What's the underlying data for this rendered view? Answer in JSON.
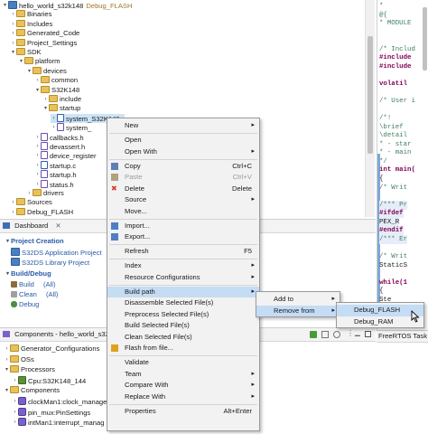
{
  "explorer": {
    "rows": [
      {
        "label": "hello_world_s32k148",
        "suffix": "Debug_FLASH",
        "indent": 0,
        "tw": "▾",
        "icon": "proj"
      },
      {
        "label": "Binaries",
        "indent": 1,
        "tw": "›",
        "icon": "folder"
      },
      {
        "label": "Includes",
        "indent": 1,
        "tw": "›",
        "icon": "folder"
      },
      {
        "label": "Generated_Code",
        "indent": 1,
        "tw": "›",
        "icon": "folder"
      },
      {
        "label": "Project_Settings",
        "indent": 1,
        "tw": "›",
        "icon": "folder"
      },
      {
        "label": "SDK",
        "indent": 1,
        "tw": "▾",
        "icon": "folder"
      },
      {
        "label": "platform",
        "indent": 2,
        "tw": "▾",
        "icon": "folder"
      },
      {
        "label": "devices",
        "indent": 3,
        "tw": "▾",
        "icon": "folder"
      },
      {
        "label": "common",
        "indent": 4,
        "tw": "›",
        "icon": "folder"
      },
      {
        "label": "S32K148",
        "indent": 4,
        "tw": "▾",
        "icon": "folder"
      },
      {
        "label": "include",
        "indent": 5,
        "tw": "›",
        "icon": "folder"
      },
      {
        "label": "startup",
        "indent": 5,
        "tw": "▾",
        "icon": "folder"
      },
      {
        "label": "system_S32K148.c",
        "indent": 6,
        "tw": "›",
        "icon": "c",
        "selected": true
      },
      {
        "label": "system_",
        "indent": 6,
        "tw": "›",
        "icon": "h"
      },
      {
        "label": "callbacks.h",
        "indent": 4,
        "tw": "›",
        "icon": "h"
      },
      {
        "label": "devassert.h",
        "indent": 4,
        "tw": "›",
        "icon": "h"
      },
      {
        "label": "device_register",
        "indent": 4,
        "tw": "›",
        "icon": "h"
      },
      {
        "label": "startup.c",
        "indent": 4,
        "tw": "›",
        "icon": "c"
      },
      {
        "label": "startup.h",
        "indent": 4,
        "tw": "›",
        "icon": "h"
      },
      {
        "label": "status.h",
        "indent": 4,
        "tw": "›",
        "icon": "h"
      },
      {
        "label": "drivers",
        "indent": 3,
        "tw": "›",
        "icon": "folder"
      },
      {
        "label": "Sources",
        "indent": 1,
        "tw": "›",
        "icon": "folder"
      },
      {
        "label": "Debug_FLASH",
        "indent": 1,
        "tw": "›",
        "icon": "folder"
      }
    ]
  },
  "dashboard": {
    "tab": "Dashboard",
    "project_creation": "Project Creation",
    "app_project": "S32DS Application Project",
    "lib_project": "S32DS Library Project",
    "build_debug": "Build/Debug",
    "build": "Build",
    "build_all": "(All)",
    "clean": "Clean",
    "clean_all": "(All)",
    "debug": "Debug"
  },
  "components": {
    "tab": "Components - hello_world_s32k14",
    "rows": [
      {
        "label": "Generator_Configurations",
        "indent": 0,
        "tw": "›",
        "icon": "folder"
      },
      {
        "label": "OSs",
        "indent": 0,
        "tw": "›",
        "icon": "folder"
      },
      {
        "label": "Processors",
        "indent": 0,
        "tw": "▾",
        "icon": "folder"
      },
      {
        "label": "Cpu:S32K148_144",
        "indent": 1,
        "tw": "›",
        "icon": "cpu"
      },
      {
        "label": "Components",
        "indent": 0,
        "tw": "▾",
        "icon": "folder"
      },
      {
        "label": "clockMan1:clock_manage",
        "indent": 1,
        "tw": "›",
        "icon": "comp"
      },
      {
        "label": "pin_mux:PinSettings",
        "indent": 1,
        "tw": "›",
        "icon": "comp"
      },
      {
        "label": "intMan1:interrupt_manag",
        "indent": 1,
        "tw": "›",
        "icon": "comp"
      }
    ]
  },
  "editor": {
    "lines": [
      {
        "t": " * ",
        "c": "cm"
      },
      {
        "t": "  @{",
        "c": "cm"
      },
      {
        "t": " * MODULE",
        "c": "cm"
      },
      {
        "t": "",
        "c": ""
      },
      {
        "t": "",
        "c": ""
      },
      {
        "t": "/* Includ",
        "c": "cm"
      },
      {
        "t": "#include ",
        "c": "pp"
      },
      {
        "t": "#include ",
        "c": "pp"
      },
      {
        "t": "",
        "c": ""
      },
      {
        "t": "  volatil",
        "c": "kw"
      },
      {
        "t": "",
        "c": ""
      },
      {
        "t": "/* User i",
        "c": "cm"
      },
      {
        "t": "",
        "c": ""
      },
      {
        "t": "/*!",
        "c": "cm"
      },
      {
        "t": "  \\brief",
        "c": "cm"
      },
      {
        "t": "  \\detail",
        "c": "cm"
      },
      {
        "t": " * - star",
        "c": "cm"
      },
      {
        "t": " * - main",
        "c": "cm"
      },
      {
        "t": " */",
        "c": "cm"
      },
      {
        "t": "int main(",
        "c": "kw"
      },
      {
        "t": "{",
        "c": ""
      },
      {
        "t": "  /* Writ",
        "c": "cm"
      },
      {
        "t": "",
        "c": ""
      },
      {
        "t": "  /*** Pr",
        "c": "cm"
      },
      {
        "t": "  #ifdef ",
        "c": "pp"
      },
      {
        "t": "    PEX_R",
        "c": ""
      },
      {
        "t": "  #endif",
        "c": "pp"
      },
      {
        "t": "  /*** Er",
        "c": "cm"
      },
      {
        "t": "",
        "c": ""
      },
      {
        "t": "  /* Writ",
        "c": "cm"
      },
      {
        "t": "  StaticS",
        "c": ""
      },
      {
        "t": "",
        "c": ""
      },
      {
        "t": "  while(1",
        "c": "kw"
      },
      {
        "t": "  {",
        "c": ""
      },
      {
        "t": "    Ste",
        "c": ""
      },
      {
        "t": "  }",
        "c": ""
      },
      {
        "t": "",
        "c": ""
      },
      {
        "t": "  /*** Do",
        "c": "cm"
      }
    ],
    "freertos_tab": "FreeRTOS Task Awa"
  },
  "context_menu": {
    "items": [
      {
        "label": "New",
        "arrow": true
      },
      {
        "sep": true
      },
      {
        "label": "Open"
      },
      {
        "label": "Open With",
        "arrow": true
      },
      {
        "sep": true
      },
      {
        "label": "Copy",
        "accel": "Ctrl+C",
        "icon": "copy"
      },
      {
        "label": "Paste",
        "accel": "Ctrl+V",
        "icon": "paste",
        "disabled": true
      },
      {
        "label": "Delete",
        "accel": "Delete",
        "icon": "delete"
      },
      {
        "label": "Source",
        "arrow": true
      },
      {
        "label": "Move..."
      },
      {
        "sep": true
      },
      {
        "label": "Import...",
        "icon": "import"
      },
      {
        "label": "Export...",
        "icon": "export"
      },
      {
        "sep": true
      },
      {
        "label": "Refresh",
        "accel": "F5"
      },
      {
        "sep": true
      },
      {
        "label": "Index",
        "arrow": true
      },
      {
        "label": "Resource Configurations",
        "arrow": true
      },
      {
        "sep": true
      },
      {
        "label": "Build path",
        "arrow": true,
        "highlight": true
      },
      {
        "label": "Disassemble Selected File(s)"
      },
      {
        "label": "Preprocess Selected File(s)"
      },
      {
        "label": "Build Selected File(s)"
      },
      {
        "label": "Clean Selected File(s)"
      },
      {
        "label": "Flash from file...",
        "icon": "flash"
      },
      {
        "sep": true
      },
      {
        "label": "Validate"
      },
      {
        "label": "Team",
        "arrow": true
      },
      {
        "label": "Compare With",
        "arrow": true
      },
      {
        "label": "Replace With",
        "arrow": true
      },
      {
        "sep": true
      },
      {
        "label": "Properties",
        "accel": "Alt+Enter"
      }
    ]
  },
  "build_path_menu": {
    "items": [
      {
        "label": "Add to",
        "arrow": true
      },
      {
        "label": "Remove from",
        "arrow": true,
        "highlight": true
      }
    ]
  },
  "remove_from_menu": {
    "items": [
      {
        "label": "Debug_FLASH",
        "highlight": true
      },
      {
        "label": "Debug_RAM"
      }
    ]
  },
  "colors": {
    "highlight": "#c5dcf5",
    "link": "#2a59a8",
    "selection": "#cde4f7"
  }
}
